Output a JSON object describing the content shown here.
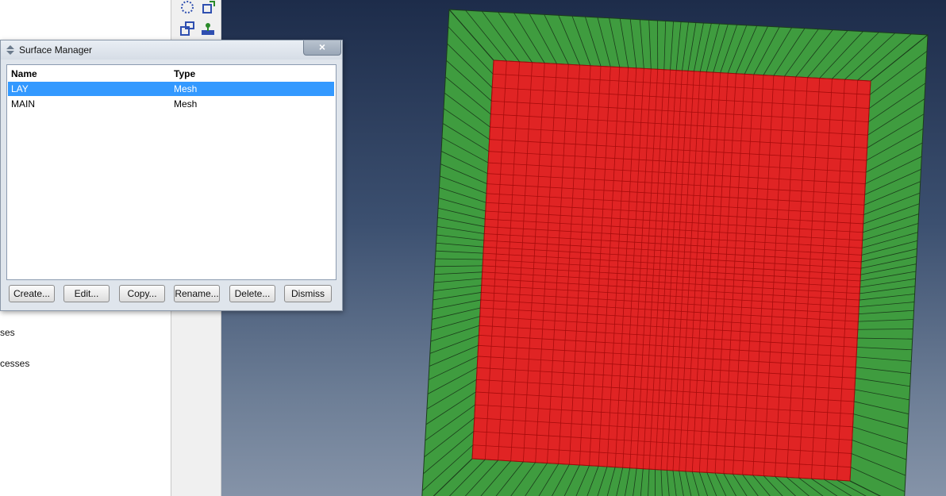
{
  "dialog": {
    "title": "Surface Manager",
    "close_label": "×",
    "columns": {
      "name": "Name",
      "type": "Type"
    },
    "rows": [
      {
        "name": "LAY",
        "type": "Mesh",
        "selected": true
      },
      {
        "name": "MAIN",
        "type": "Mesh",
        "selected": false
      }
    ],
    "buttons": {
      "create": "Create...",
      "edit": "Edit...",
      "copy": "Copy...",
      "rename": "Rename...",
      "delete": "Delete...",
      "dismiss": "Dismiss"
    }
  },
  "model_tree": {
    "item_1": "ses",
    "item_2": "cesses"
  },
  "colors": {
    "selection": "#3399ff",
    "mesh_green": "#3f9c3f",
    "mesh_red": "#e02424"
  },
  "icons": [
    "surface-manager-icon",
    "close-icon",
    "circle-select-icon",
    "transform-icon",
    "copy-part-icon",
    "partition-icon"
  ]
}
